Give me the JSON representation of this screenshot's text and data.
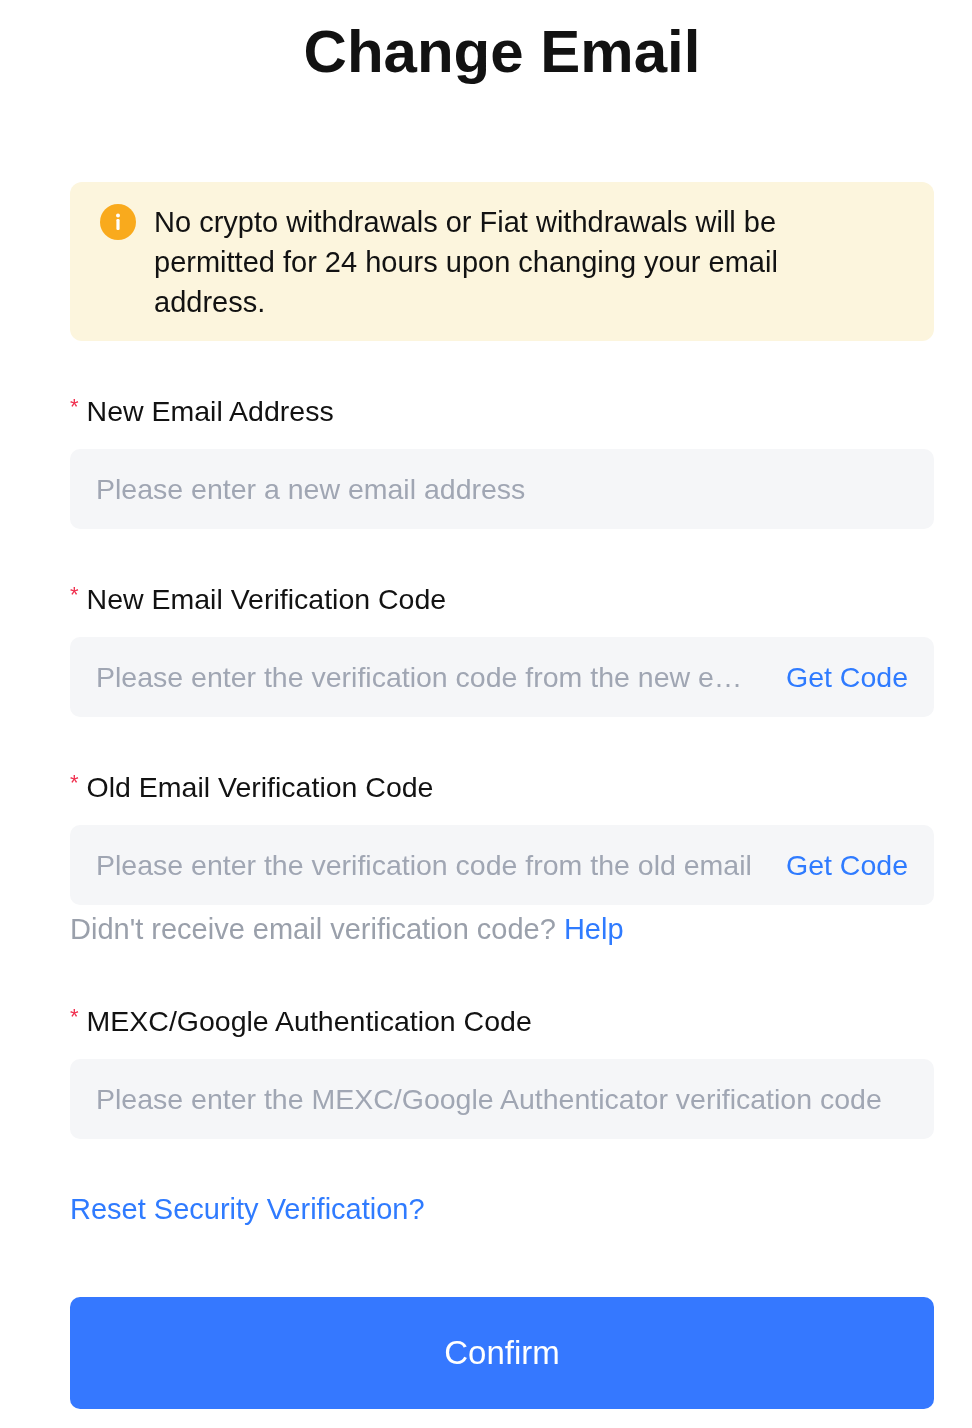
{
  "title": "Change Email",
  "notice": {
    "text": "No crypto withdrawals or Fiat withdrawals will be permitted for 24 hours upon changing your email address."
  },
  "fields": [
    {
      "label": "New Email Address",
      "required_mark": "*",
      "placeholder": "Please enter a new email address"
    },
    {
      "label": "New Email Verification Code",
      "required_mark": "*",
      "placeholder": "Please enter the verification code from the new e…",
      "action": "Get Code"
    },
    {
      "label": "Old Email Verification Code",
      "required_mark": "*",
      "placeholder": "Please enter the verification code from the old email",
      "action": "Get Code",
      "help": {
        "text": "Didn't receive email verification code?",
        "link": "Help"
      }
    },
    {
      "label": "MEXC/Google Authentication Code",
      "required_mark": "*",
      "placeholder": "Please enter the MEXC/Google Authenticator verification code"
    }
  ],
  "reset_link": "Reset Security Verification?",
  "confirm_button": "Confirm"
}
